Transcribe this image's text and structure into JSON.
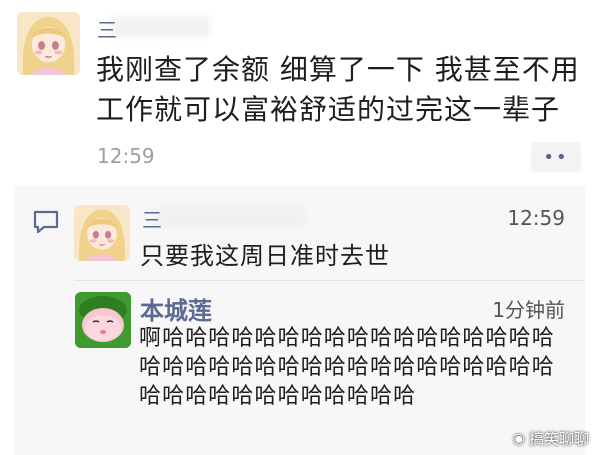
{
  "post": {
    "author_name": "三",
    "text": "我刚查了余额  细算了一下   我甚至不用工作就可以富裕舒适的过完这一辈子",
    "time": "12:59",
    "more_icon": "more-dots-icon",
    "more_label": "••"
  },
  "comments": [
    {
      "author_name": "三",
      "time": "12:59",
      "text": "只要我这周日准时去世"
    },
    {
      "author_name": "本城莲",
      "time": "1分钟前",
      "text": "啊哈哈哈哈哈哈哈哈哈哈哈哈哈哈哈哈哈哈哈哈哈哈哈哈哈哈哈哈哈哈哈哈哈哈哈哈哈哈哈哈哈哈哈哈哈哈哈"
    }
  ],
  "comment_icon": "comment-bubble-icon",
  "watermark": {
    "icon": "wechat-icon",
    "text": "搞笑聊聊"
  },
  "colors": {
    "name": "#5b6a92",
    "background": "#ffffff",
    "comment_background": "#f7f7f7"
  }
}
